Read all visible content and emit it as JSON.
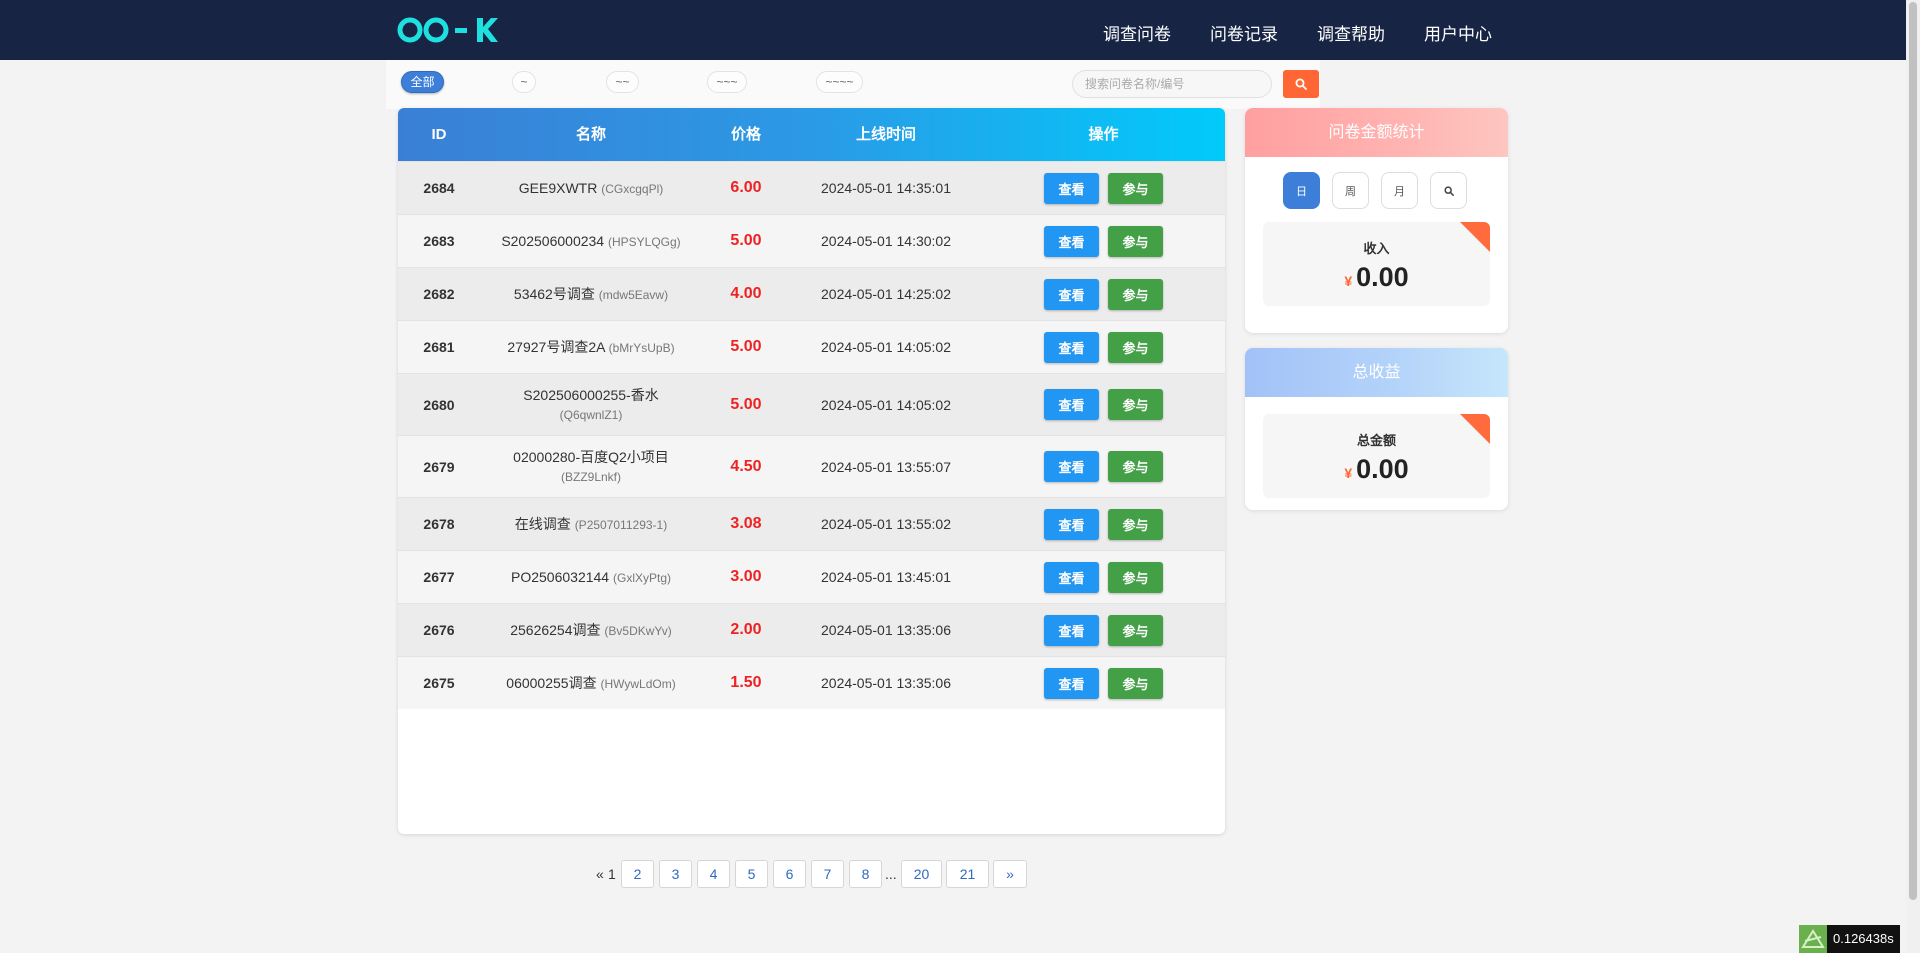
{
  "header": {
    "logo_text": "OO-K",
    "nav": [
      "调查问卷",
      "问卷记录",
      "调查帮助",
      "用户中心"
    ]
  },
  "filters": {
    "chips": [
      "全部",
      "~",
      "~~",
      "~~~",
      "~~~~"
    ],
    "active_index": 0,
    "search_placeholder": "搜索问卷名称/编号"
  },
  "table": {
    "headers": [
      "ID",
      "名称",
      "价格",
      "上线时间",
      "操作"
    ],
    "view_label": "查看",
    "join_label": "参与",
    "rows": [
      {
        "id": "2684",
        "name": "GEE9XWTR",
        "code": "(CGxcgqPl)",
        "price": "6.00",
        "time": "2024-05-01 14:35:01"
      },
      {
        "id": "2683",
        "name": "S202506000234",
        "code": "(HPSYLQGg)",
        "price": "5.00",
        "time": "2024-05-01 14:30:02"
      },
      {
        "id": "2682",
        "name": "53462号调查",
        "code": "(mdw5Eavw)",
        "price": "4.00",
        "time": "2024-05-01 14:25:02"
      },
      {
        "id": "2681",
        "name": "27927号调查2A",
        "code": "(bMrYsUpB)",
        "price": "5.00",
        "time": "2024-05-01 14:05:02"
      },
      {
        "id": "2680",
        "name": "S202506000255-香水",
        "code": "(Q6qwnlZ1)",
        "price": "5.00",
        "time": "2024-05-01 14:05:02"
      },
      {
        "id": "2679",
        "name": "02000280-百度Q2小项目",
        "code": "(BZZ9Lnkf)",
        "price": "4.50",
        "time": "2024-05-01 13:55:07"
      },
      {
        "id": "2678",
        "name": "在线调查",
        "code": "(P2507011293-1)",
        "price": "3.08",
        "time": "2024-05-01 13:55:02"
      },
      {
        "id": "2677",
        "name": "PO2506032144",
        "code": "(GxlXyPtg)",
        "price": "3.00",
        "time": "2024-05-01 13:45:01"
      },
      {
        "id": "2676",
        "name": "25626254调查",
        "code": "(Bv5DKwYv)",
        "price": "2.00",
        "time": "2024-05-01 13:35:06"
      },
      {
        "id": "2675",
        "name": "06000255调查",
        "code": "(HWywLdOm)",
        "price": "1.50",
        "time": "2024-05-01 13:35:06"
      }
    ]
  },
  "pagination": {
    "prev": "«",
    "current": "1",
    "pages": [
      "2",
      "3",
      "4",
      "5",
      "6",
      "7",
      "8"
    ],
    "ellipsis": "...",
    "last_pages": [
      "20",
      "21"
    ],
    "next": "»"
  },
  "stats_widget": {
    "title": "问卷金额统计",
    "periods": [
      "日",
      "周",
      "月"
    ],
    "active_period": 0,
    "label": "收入",
    "currency": "¥",
    "value": "0.00"
  },
  "earnings_widget": {
    "title": "总收益",
    "label": "总金额",
    "currency": "¥",
    "value": "0.00"
  },
  "timer_text": "0.126438s",
  "colors": {
    "header_bg": "#172444",
    "accent": "#3c7ed8",
    "price": "#e22222",
    "search_button": "#ff6633",
    "view_button": "#2196f3",
    "join_button": "#43a047"
  }
}
